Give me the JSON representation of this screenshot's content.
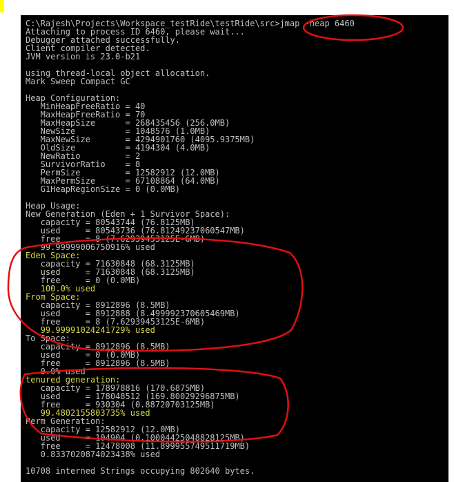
{
  "console": {
    "lines": [
      {
        "text": "C:\\Rajesh\\Projects\\Workspace_testRide\\testRide\\src>jmap -heap 6460"
      },
      {
        "text": "Attaching to process ID 6460, please wait..."
      },
      {
        "text": "Debugger attached successfully."
      },
      {
        "text": "Client compiler detected."
      },
      {
        "text": "JVM version is 23.0-b21"
      },
      {
        "text": ""
      },
      {
        "text": "using thread-local object allocation."
      },
      {
        "text": "Mark Sweep Compact GC"
      },
      {
        "text": ""
      },
      {
        "text": "Heap Configuration:"
      },
      {
        "text": "   MinHeapFreeRatio = 40"
      },
      {
        "text": "   MaxHeapFreeRatio = 70"
      },
      {
        "text": "   MaxHeapSize      = 268435456 (256.0MB)"
      },
      {
        "text": "   NewSize          = 1048576 (1.0MB)"
      },
      {
        "text": "   MaxNewSize       = 4294901760 (4095.9375MB)"
      },
      {
        "text": "   OldSize          = 4194304 (4.0MB)"
      },
      {
        "text": "   NewRatio         = 2"
      },
      {
        "text": "   SurvivorRatio    = 8"
      },
      {
        "text": "   PermSize         = 12582912 (12.0MB)"
      },
      {
        "text": "   MaxPermSize      = 67108864 (64.0MB)"
      },
      {
        "text": "   G1HeapRegionSize = 0 (0.0MB)"
      },
      {
        "text": ""
      },
      {
        "text": "Heap Usage:"
      },
      {
        "text": "New Generation (Eden + 1 Survivor Space):"
      },
      {
        "text": "   capacity = 80543744 (76.8125MB)"
      },
      {
        "text": "   used     = 80543736 (76.81249237060547MB)"
      },
      {
        "text": "   free     = 8 (7.62939453125E-6MB)"
      },
      {
        "text": "   99.99999006750916% used"
      },
      {
        "text": "Eden Space:",
        "hl": true
      },
      {
        "text": "   capacity = 71630848 (68.3125MB)"
      },
      {
        "text": "   used     = 71630848 (68.3125MB)"
      },
      {
        "text": "   free     = 0 (0.0MB)"
      },
      {
        "text": "   100.0% used",
        "hl": true
      },
      {
        "text": "From Space:",
        "hl": true
      },
      {
        "text": "   capacity = 8912896 (8.5MB)"
      },
      {
        "text": "   used     = 8912888 (8.499992370605469MB)"
      },
      {
        "text": "   free     = 8 (7.62939453125E-6MB)"
      },
      {
        "text": "   99.99991024241729% used",
        "hl": true
      },
      {
        "text": "To Space:"
      },
      {
        "text": "   capacity = 8912896 (8.5MB)"
      },
      {
        "text": "   used     = 0 (0.0MB)"
      },
      {
        "text": "   free     = 8912896 (8.5MB)"
      },
      {
        "text": "   0.0% used"
      },
      {
        "text": "tenured generation:",
        "hl": true
      },
      {
        "text": "   capacity = 178978816 (170.6875MB)"
      },
      {
        "text": "   used     = 178048512 (169.80029296875MB)"
      },
      {
        "text": "   free     = 930304 (0.88720703125MB)"
      },
      {
        "text": "   99.4802155803735% used",
        "hl": true
      },
      {
        "text": "Perm Generation:"
      },
      {
        "text": "   capacity = 12582912 (12.0MB)"
      },
      {
        "text": "   used     = 104904 (0.10004425048828125MB)"
      },
      {
        "text": "   free     = 12478008 (11.899955749511719MB)"
      },
      {
        "text": "   0.8337020874023438% used"
      },
      {
        "text": ""
      },
      {
        "text": "10708 interned Strings occupying 802640 bytes."
      }
    ]
  },
  "colors": {
    "console_bg": "#000000",
    "console_text": "#c0c0c0",
    "highlight_text": "#d8d84a",
    "annotation": "#e01010",
    "corner_mark": "#ffff00"
  }
}
